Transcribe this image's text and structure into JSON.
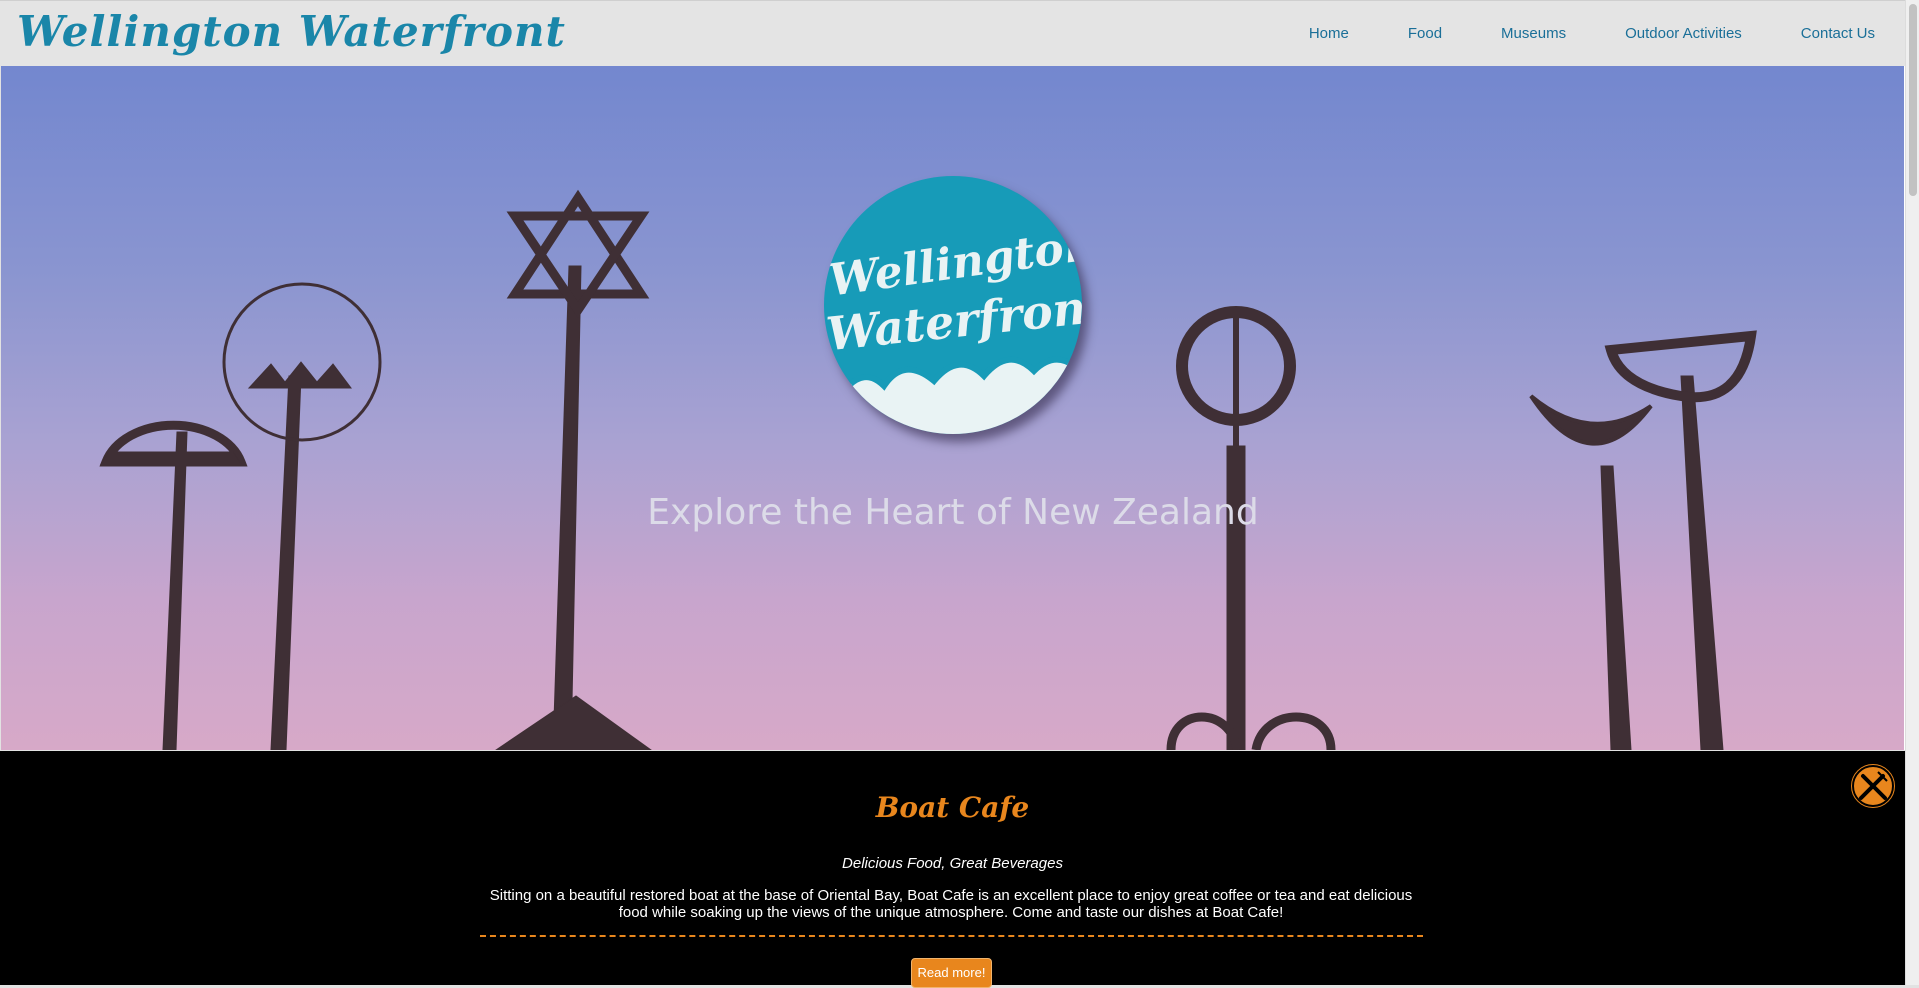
{
  "header": {
    "brand": "Wellington Waterfront",
    "nav": [
      "Home",
      "Food",
      "Museums",
      "Outdoor Activities",
      "Contact Us"
    ]
  },
  "hero": {
    "logo_line1": "Wellington",
    "logo_line2": "Waterfront",
    "tagline": "Explore the Heart of New Zealand"
  },
  "section": {
    "title": "Boat Cafe",
    "subtitle": "Delicious Food, Great Beverages",
    "description": "Sitting on a beautiful restored boat at the base of Oriental Bay, Boat Cafe is an excellent place to enjoy great coffee or tea and eat delicious food while soaking up the views of the unique atmosphere. Come and taste our dishes at Boat Cafe!",
    "button": "Read more!",
    "icon": "utensils-icon"
  },
  "colors": {
    "brand_blue": "#1a86a9",
    "accent_orange": "#e8861d",
    "logo_teal": "#179bb8"
  }
}
